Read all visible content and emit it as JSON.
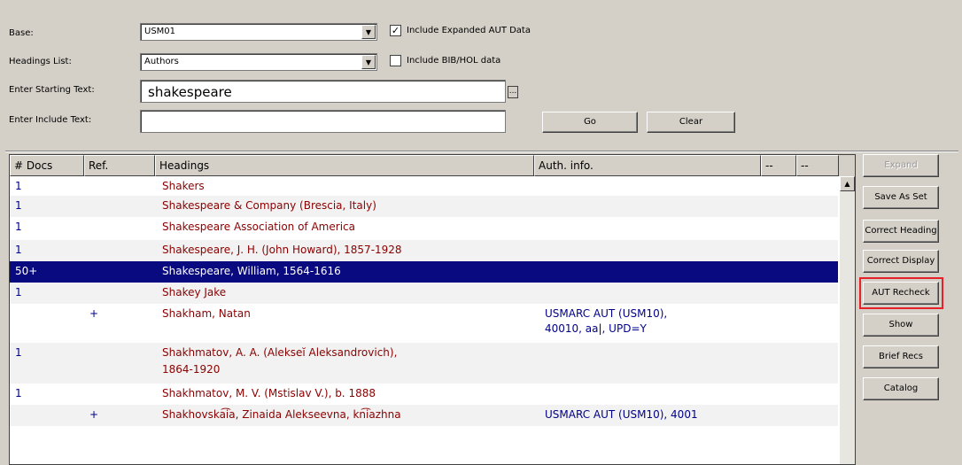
{
  "form": {
    "base_label": "Base:",
    "base_value": "USM01",
    "include_aut_label": "Include Expanded AUT Data",
    "include_aut_checked": true,
    "headings_list_label": "Headings List:",
    "headings_list_value": "Authors",
    "include_bib_label": "Include BIB/HOL data",
    "include_bib_checked": false,
    "starting_text_label": "Enter Starting Text:",
    "starting_text_value": "shakespeare",
    "ellipsis_label": "...",
    "include_text_label": "Enter Include Text:",
    "include_text_value": "",
    "go_label": "Go",
    "clear_label": "Clear"
  },
  "list": {
    "columns": [
      "# Docs",
      "Ref.",
      "Headings",
      "Auth. info.",
      "--",
      "--"
    ],
    "rows": [
      {
        "docs": "1",
        "ref": "",
        "heading": "Shakers",
        "auth": ""
      },
      {
        "docs": "1",
        "ref": "",
        "heading": "Shakespeare & Company (Brescia, Italy)",
        "auth": ""
      },
      {
        "docs": "1",
        "ref": "",
        "heading": "Shakespeare Association of America",
        "auth": ""
      },
      {
        "docs": "1",
        "ref": "",
        "heading": "Shakespeare, J. H. (John Howard), 1857-1928",
        "auth": ""
      },
      {
        "docs": "50+",
        "ref": "",
        "heading": "Shakespeare, William, 1564-1616",
        "auth": ""
      },
      {
        "docs": "1",
        "ref": "",
        "heading": "Shakey Jake",
        "auth": ""
      },
      {
        "docs": "",
        "ref": "+",
        "heading": "Shakham, Natan",
        "auth": "USMARC AUT (USM10),",
        "auth2": "40010, aa|, UPD=Y"
      },
      {
        "docs": "1",
        "ref": "",
        "heading": "Shakhmatov, A. A. (Alekseĭ Aleksandrovich),",
        "heading2": "1864-1920",
        "auth": ""
      },
      {
        "docs": "1",
        "ref": "",
        "heading": "Shakhmatov, M. V. (Mstislav V.), b. 1888",
        "auth": ""
      },
      {
        "docs": "",
        "ref": "+",
        "heading": "Shakhovska͡ia, Zinaida Alekseevna, kn͡iazhna",
        "auth": "USMARC AUT (USM10), 4001"
      }
    ],
    "selected_index": 4
  },
  "side_buttons": {
    "expand": "Expand",
    "save_as_set": "Save As Set",
    "correct_heading": "Correct Heading",
    "correct_display": "Correct Display",
    "aut_recheck": "AUT Recheck",
    "show": "Show",
    "brief_recs": "Brief Recs",
    "catalog": "Catalog"
  },
  "icons": {
    "dropdown": "chevron-down-icon",
    "checkbox": "checkbox-icon",
    "scroll_up": "arrow-up-icon"
  },
  "colors": {
    "selection": "#0a0a80",
    "heading_text": "#8b0000",
    "highlight_box": "#e8202a"
  }
}
